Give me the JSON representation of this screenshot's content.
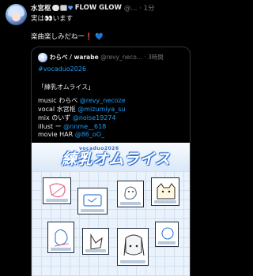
{
  "tweet": {
    "author_name": "水宮枢",
    "author_name_suffix": "FLOW GLOW",
    "meta": "@... · 1分",
    "line1_pre": "実は",
    "line1_emoji": "👀",
    "line1_post": "います",
    "line2": "楽曲楽しみだねー❗️",
    "line2_heart": "💙"
  },
  "quote": {
    "author_name": "わらべ / warabe",
    "meta": "@revy_neco... · 3時間",
    "hashtag": "#vocaduo2026",
    "title": "「練乳オムライス」",
    "credits": [
      {
        "role": "music わらべ ",
        "handle": "@revy_necoze"
      },
      {
        "role": "vocal 水宮枢 ",
        "handle": "@mizumiya_su"
      },
      {
        "role": "mix のいず ",
        "handle": "@noise19274"
      },
      {
        "role": "illust ー ",
        "handle": "@nnme__618"
      },
      {
        "role": "movie HAR ",
        "handle": "@86_oO_"
      }
    ],
    "artwork": {
      "logo_text": "練乳オムライス",
      "logo_sub": "vocaduo2026"
    }
  },
  "colors": {
    "background": "#000000",
    "text": "#e7e9ea",
    "muted": "#71767b",
    "link": "#1d9bf0",
    "border": "#2f3336"
  }
}
